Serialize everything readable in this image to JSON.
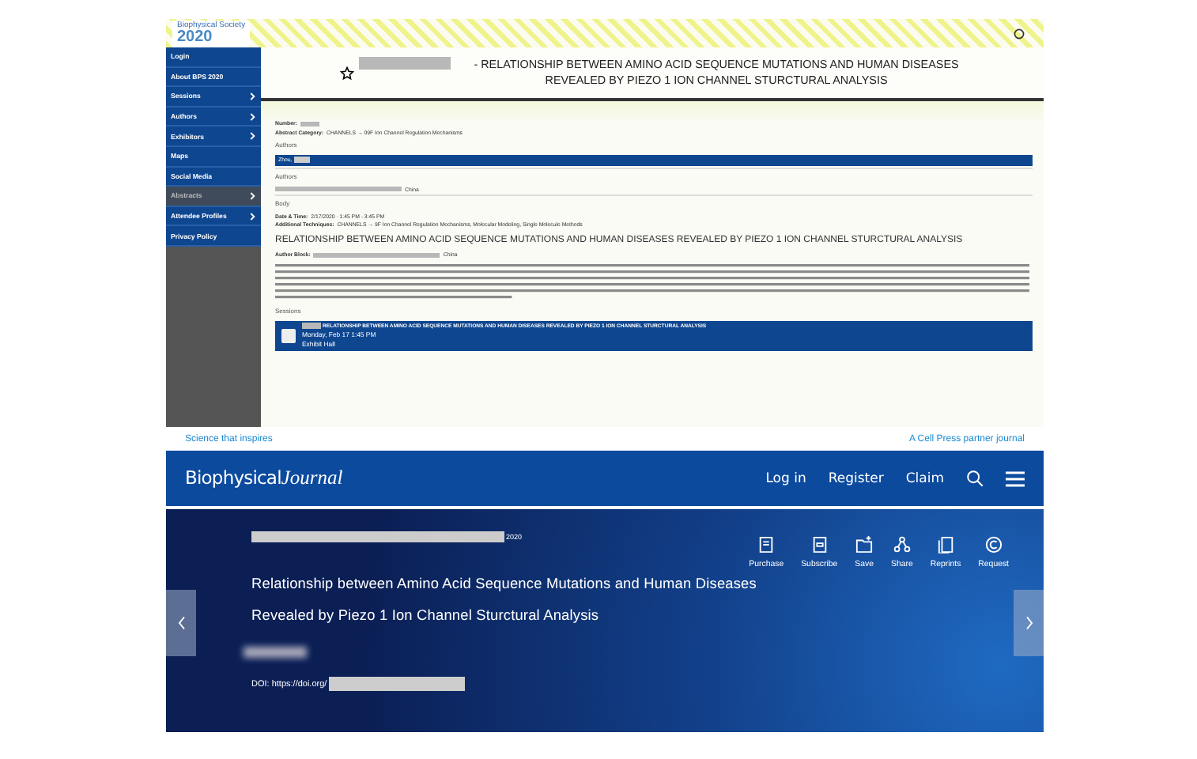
{
  "conference": {
    "logo_year": "2020",
    "logo_org": "Biophysical Society"
  },
  "sidebar": {
    "items": [
      {
        "label": "Login",
        "has_arrow": false,
        "selected": false
      },
      {
        "label": "About BPS 2020",
        "has_arrow": false,
        "selected": false
      },
      {
        "label": "Sessions",
        "has_arrow": true,
        "selected": false
      },
      {
        "label": "Authors",
        "has_arrow": true,
        "selected": false
      },
      {
        "label": "Exhibitors",
        "has_arrow": true,
        "selected": false
      },
      {
        "label": "Maps",
        "has_arrow": false,
        "selected": false
      },
      {
        "label": "Social Media",
        "has_arrow": false,
        "selected": false
      },
      {
        "label": "Abstracts",
        "has_arrow": true,
        "selected": true
      },
      {
        "label": "Attendee Profiles",
        "has_arrow": true,
        "selected": false
      },
      {
        "label": "Privacy Policy",
        "has_arrow": false,
        "selected": false
      }
    ]
  },
  "abstract": {
    "title": "- RELATIONSHIP BETWEEN AMINO ACID SEQUENCE MUTATIONS AND HUMAN DISEASES REVEALED BY PIEZO 1 ION CHANNEL STURCTURAL ANALYSIS",
    "fields": [
      {
        "label": "Number:"
      },
      {
        "label": "Abstract Category:",
        "value": "CHANNELS → 09F Ion Channel Regulation Mechanisms"
      }
    ],
    "authors_heading": "Authors",
    "author_chip": "Zhou,",
    "authors_heading_2": "Authors",
    "affiliation": "China",
    "body_heading": "Body",
    "details": [
      {
        "label": "Date & Time:",
        "value": "2/17/2020 · 1:45 PM - 3:45 PM"
      },
      {
        "label": "Additional Techniques:",
        "value": "CHANNELS → 9F Ion Channel Regulation Mechanisms, Molecular Modeling, Single Molecule Methods"
      }
    ],
    "heading": "RELATIONSHIP BETWEEN AMINO ACID SEQUENCE MUTATIONS AND HUMAN DISEASES REVEALED BY PIEZO 1 ION CHANNEL STURCTURAL ANALYSIS",
    "author_block_label": "Author Block:",
    "author_block_value": "China",
    "sessions_heading": "Sessions",
    "session": {
      "title": "RELATIONSHIP BETWEEN AMINO ACID SEQUENCE MUTATIONS AND HUMAN DISEASES REVEALED BY PIEZO 1 ION CHANNEL STURCTURAL ANALYSIS",
      "time": "Monday, Feb 17 1:45 PM",
      "place": "Exhibit Hall"
    }
  },
  "journal": {
    "tagline": "Science that inspires",
    "partner": "A Cell Press partner journal",
    "logo_main": "Biophysical",
    "logo_italic": "Journal",
    "nav": [
      "Log in",
      "Register",
      "Claim"
    ],
    "date": "2020",
    "actions": [
      {
        "kind": "purchase",
        "label": "Purchase"
      },
      {
        "kind": "subscribe",
        "label": "Subscribe"
      },
      {
        "kind": "save",
        "label": "Save"
      },
      {
        "kind": "share",
        "label": "Share"
      },
      {
        "kind": "reprints",
        "label": "Reprints"
      },
      {
        "kind": "request",
        "label": "Request"
      }
    ],
    "title": "Relationship between Amino Acid Sequence Mutations and Human Diseases Revealed by Piezo 1 Ion Channel Sturctural Analysis",
    "doi_label": "DOI: https://doi.org/"
  }
}
